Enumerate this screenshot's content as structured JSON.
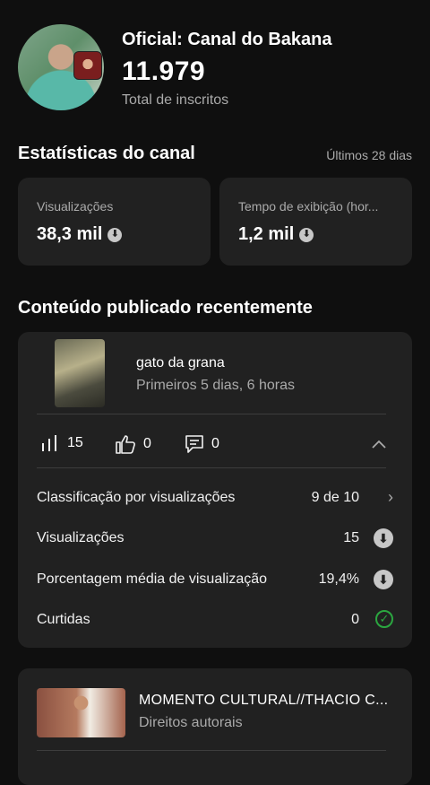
{
  "channel": {
    "name": "Oficial: Canal do Bakana",
    "subscriber_count": "11.979",
    "subscriber_label": "Total de inscritos"
  },
  "stats": {
    "title": "Estatísticas do canal",
    "period": "Últimos 28 dias",
    "cards": [
      {
        "label": "Visualizações",
        "value": "38,3 mil",
        "trend_icon": "arrow-down-circle-icon"
      },
      {
        "label": "Tempo de exibição (hor...",
        "value": "1,2 mil",
        "trend_icon": "arrow-down-circle-icon"
      }
    ]
  },
  "recent": {
    "title": "Conteúdo publicado recentemente",
    "video1": {
      "title": "gato da grana",
      "subtitle": "Primeiros 5 dias, 6 horas",
      "views": "15",
      "likes": "0",
      "comments": "0",
      "details": [
        {
          "label": "Classificação por visualizações",
          "value": "9 de 10",
          "icon": "chevron-right-icon"
        },
        {
          "label": "Visualizações",
          "value": "15",
          "icon": "arrow-down-circle-icon"
        },
        {
          "label": "Porcentagem média de visualização",
          "value": "19,4%",
          "icon": "arrow-down-circle-icon"
        },
        {
          "label": "Curtidas",
          "value": "0",
          "icon": "check-circle-icon"
        }
      ]
    },
    "video2": {
      "title": "MOMENTO CULTURAL//THACIO C...",
      "subtitle": "Direitos autorais"
    }
  },
  "icons": {
    "down": "⬇",
    "check": "✓",
    "chevron_right": "›",
    "chevron_up": "︿"
  },
  "colors": {
    "background": "#0f0f0f",
    "card": "#212121",
    "muted_text": "#aaaaaa",
    "success": "#2ba640"
  }
}
